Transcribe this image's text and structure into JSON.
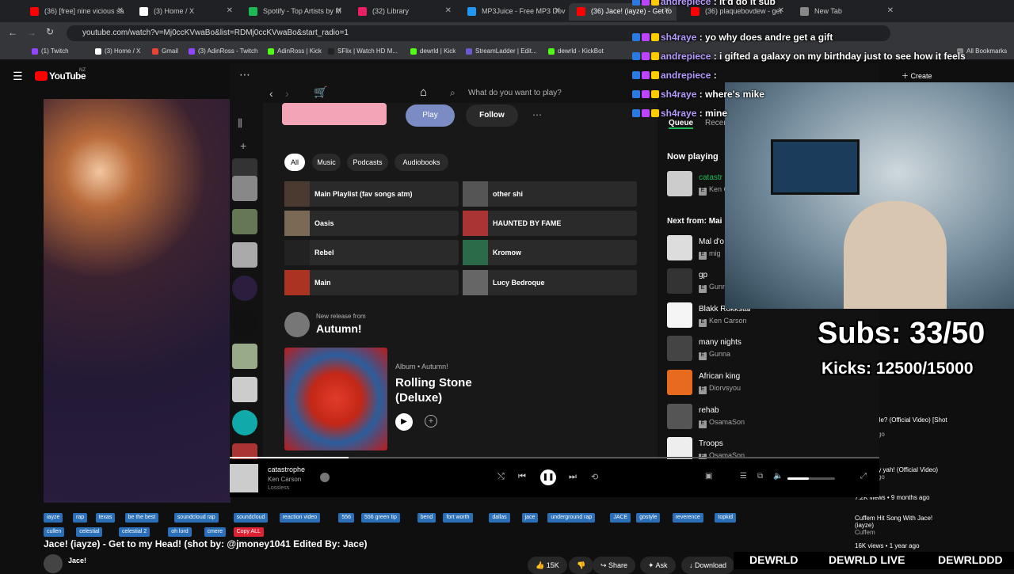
{
  "browser": {
    "tabs": [
      {
        "label": "(36) [free] nine vicious sa",
        "color": "#ff0000"
      },
      {
        "label": "(3) Home / X",
        "color": "#ffffff"
      },
      {
        "label": "Spotify - Top Artists by M",
        "color": "#1db954"
      },
      {
        "label": "(32) Library",
        "color": "#e91e63"
      },
      {
        "label": "MP3Juice - Free MP3 Dov",
        "color": "#2196f3"
      },
      {
        "label": "(36) Jace! (iayze) - Get to",
        "color": "#ff0000"
      },
      {
        "label": "(36) plaquebovdew - get",
        "color": "#ff0000"
      },
      {
        "label": "New Tab",
        "color": "#888888"
      }
    ],
    "url": "youtube.com/watch?v=Mj0ccKVwaBo&list=RDMj0ccKVwaBo&start_radio=1",
    "bookmarks": [
      "(1) Twitch",
      "(3) Home / X",
      "Gmail",
      "(3) AdinRoss - Twitch",
      "AdinRoss | Kick",
      "SFlix | Watch HD M...",
      "dewrld | Kick",
      "StreamLadder | Edit...",
      "dewrld - KickBot",
      "All Bookmarks"
    ]
  },
  "youtube": {
    "logo": "YouTube",
    "region": "NZ",
    "title": "Jace! (iayze) - Get to my Head! (shot by: @jmoney1041 Edited By: Jace)",
    "channel": "Jace!",
    "tags": [
      "iayze",
      "rap",
      "texas",
      "be the best",
      "soundcloud rap",
      "soundcloud",
      "reaction video",
      "556",
      "556 green tip",
      "bend",
      "fort worth",
      "dallas",
      "jace",
      "underground rap",
      "JACE",
      "gostyle",
      "reverence",
      "topkid",
      "cullen",
      "celestial",
      "celestial 2",
      "oh lord",
      "cmere",
      "Copy ALL"
    ],
    "actions": {
      "likes": "15K",
      "share": "Share",
      "ask": "Ask",
      "download": "Download"
    },
    "sidebar": [
      {
        "title": "Who is He? (Official Video) [Shot By: ...",
        "meta": "1 year ago"
      },
      {
        "title": "man - my yah! (Official Video)",
        "meta": "1 year ago"
      },
      {
        "title": "7.2K views • 9 months ago",
        "meta": ""
      },
      {
        "title": "Cuffem Hit Song With Jace! (iayze)",
        "meta": "Cuffem"
      },
      {
        "title": "16K views • 1 year ago",
        "meta": ""
      }
    ]
  },
  "spotify": {
    "search_placeholder": "What do you want to play?",
    "hero": {
      "play": "Play",
      "follow": "Follow"
    },
    "filters": [
      "All",
      "Music",
      "Podcasts",
      "Audiobooks"
    ],
    "quick": [
      {
        "label": "Main Playlist (fav songs atm)",
        "color": "#4a3a30"
      },
      {
        "label": "other shi",
        "color": "#555"
      },
      {
        "label": "Oasis",
        "color": "#7a6a55"
      },
      {
        "label": "HAUNTED BY FAME",
        "color": "#a33"
      },
      {
        "label": "Rebel",
        "color": "#222"
      },
      {
        "label": "Kromow",
        "color": "#2b6b4a"
      },
      {
        "label": "Main",
        "color": "#aa3322"
      },
      {
        "label": "Lucy Bedroque",
        "color": "#666"
      }
    ],
    "new_release": {
      "from_label": "New release from",
      "artist": "Autumn!",
      "type": "Album • Autumn!",
      "title": "Rolling Stone (Deluxe)"
    },
    "queue": {
      "tabs": [
        "Queue",
        "Recen"
      ],
      "now_playing_label": "Now playing",
      "now_playing": {
        "title": "catastr",
        "artist": "Ken C"
      },
      "next_label": "Next from: Mai",
      "items": [
        {
          "title": "Mal d'o",
          "artist": "mig",
          "color": "#ddd"
        },
        {
          "title": "gp",
          "artist": "Gunn",
          "color": "#333"
        },
        {
          "title": "Blakk Rokkstar",
          "artist": "Ken Carson",
          "color": "#f5f5f5"
        },
        {
          "title": "many nights",
          "artist": "Gunna",
          "color": "#444"
        },
        {
          "title": "African king",
          "artist": "Diorvsyou",
          "color": "#e86a1e"
        },
        {
          "title": "rehab",
          "artist": "OsamaSon",
          "color": "#555"
        },
        {
          "title": "Troops",
          "artist": "OsamaSon",
          "color": "#eee"
        }
      ]
    },
    "player": {
      "title": "catastrophe",
      "artist": "Ken Carson",
      "quality": "Lossless",
      "progress": 0.5,
      "volume": 0.45
    }
  },
  "stream": {
    "chat": [
      {
        "name": "andrepiece",
        "msg": "it'd do it sub"
      },
      {
        "name": "sh4raye",
        "msg": "yo why does andre get a gift"
      },
      {
        "name": "andrepiece",
        "msg": "i gifted a galaxy on my birthday just to see how it feels"
      },
      {
        "name": "andrepiece",
        "msg": ""
      },
      {
        "name": "sh4raye",
        "msg": "where's mike"
      },
      {
        "name": "sh4raye",
        "msg": "mine"
      }
    ],
    "subs": "Subs: 33/50",
    "kicks": "Kicks: 12500/15000",
    "socials": [
      "DEWRLD",
      "DEWRLD LIVE",
      "DEWRLDDD"
    ],
    "create": "Create"
  }
}
